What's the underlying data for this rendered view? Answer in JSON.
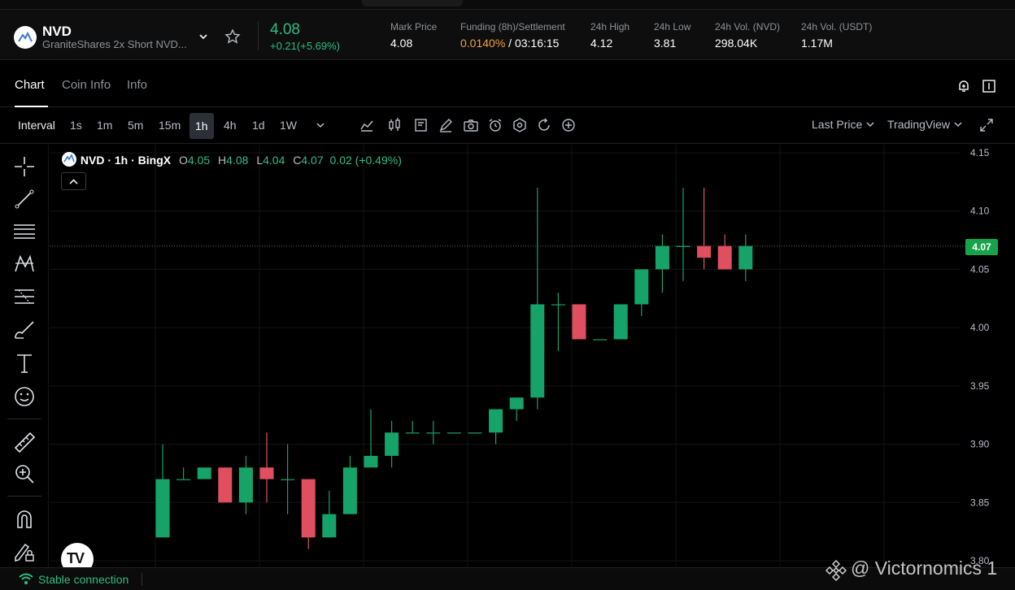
{
  "header": {
    "symbol": "NVD",
    "full_name": "GraniteShares 2x Short NVD...",
    "last_price": "4.08",
    "change": "+0.21(+5.69%)",
    "stats": [
      {
        "label": "Mark Price",
        "value": "4.08"
      },
      {
        "label": "24h High",
        "value": "4.12"
      },
      {
        "label": "24h Low",
        "value": "3.81"
      },
      {
        "label": "24h Vol. (NVD)",
        "value": "298.04K"
      },
      {
        "label": "24h Vol. (USDT)",
        "value": "1.17M"
      }
    ],
    "funding": {
      "label": "Funding (8h)/Settlement",
      "rate": "0.0140%",
      "countdown": " / 03:16:15"
    }
  },
  "tabs": [
    "Chart",
    "Coin Info",
    "Info"
  ],
  "toolbar": {
    "interval_label": "Interval",
    "intervals": [
      "1s",
      "1m",
      "5m",
      "15m",
      "1h",
      "4h",
      "1d",
      "1W"
    ],
    "selected_interval": "1h",
    "price_source": "Last Price",
    "chart_provider": "TradingView"
  },
  "legend": {
    "title": "NVD · 1h · BingX",
    "o_label": "O",
    "o": "4.05",
    "h_label": "H",
    "h": "4.08",
    "l_label": "L",
    "l": "4.04",
    "c_label": "C",
    "c": "4.07",
    "chg": "0.02 (+0.49%)"
  },
  "chart_data": {
    "type": "candlestick",
    "ylim": [
      3.8,
      4.15
    ],
    "y_ticks": [
      "4.15",
      "4.10",
      "4.05",
      "4.00",
      "3.95",
      "3.90",
      "3.85",
      "3.80"
    ],
    "current_price": "4.07",
    "candles": [
      {
        "o": 3.82,
        "h": 3.9,
        "l": 3.82,
        "c": 3.87
      },
      {
        "o": 3.87,
        "h": 3.88,
        "l": 3.87,
        "c": 3.87
      },
      {
        "o": 3.87,
        "h": 3.88,
        "l": 3.87,
        "c": 3.88
      },
      {
        "o": 3.88,
        "h": 3.88,
        "l": 3.85,
        "c": 3.85
      },
      {
        "o": 3.85,
        "h": 3.89,
        "l": 3.84,
        "c": 3.88
      },
      {
        "o": 3.88,
        "h": 3.91,
        "l": 3.85,
        "c": 3.87
      },
      {
        "o": 3.87,
        "h": 3.9,
        "l": 3.84,
        "c": 3.87
      },
      {
        "o": 3.87,
        "h": 3.87,
        "l": 3.81,
        "c": 3.82
      },
      {
        "o": 3.82,
        "h": 3.86,
        "l": 3.82,
        "c": 3.84
      },
      {
        "o": 3.84,
        "h": 3.89,
        "l": 3.84,
        "c": 3.88
      },
      {
        "o": 3.88,
        "h": 3.93,
        "l": 3.88,
        "c": 3.89
      },
      {
        "o": 3.89,
        "h": 3.92,
        "l": 3.88,
        "c": 3.91
      },
      {
        "o": 3.91,
        "h": 3.92,
        "l": 3.91,
        "c": 3.91
      },
      {
        "o": 3.91,
        "h": 3.92,
        "l": 3.9,
        "c": 3.91
      },
      {
        "o": 3.91,
        "h": 3.91,
        "l": 3.91,
        "c": 3.91
      },
      {
        "o": 3.91,
        "h": 3.91,
        "l": 3.91,
        "c": 3.91
      },
      {
        "o": 3.91,
        "h": 3.93,
        "l": 3.9,
        "c": 3.93
      },
      {
        "o": 3.93,
        "h": 3.94,
        "l": 3.92,
        "c": 3.94
      },
      {
        "o": 3.94,
        "h": 4.12,
        "l": 3.93,
        "c": 4.02
      },
      {
        "o": 4.02,
        "h": 4.03,
        "l": 3.98,
        "c": 4.02
      },
      {
        "o": 4.02,
        "h": 4.02,
        "l": 3.99,
        "c": 3.99
      },
      {
        "o": 3.99,
        "h": 3.99,
        "l": 3.99,
        "c": 3.99
      },
      {
        "o": 3.99,
        "h": 4.02,
        "l": 3.99,
        "c": 4.02
      },
      {
        "o": 4.02,
        "h": 4.05,
        "l": 4.01,
        "c": 4.05
      },
      {
        "o": 4.05,
        "h": 4.08,
        "l": 4.03,
        "c": 4.07
      },
      {
        "o": 4.07,
        "h": 4.12,
        "l": 4.04,
        "c": 4.07
      },
      {
        "o": 4.07,
        "h": 4.12,
        "l": 4.05,
        "c": 4.06
      },
      {
        "o": 4.07,
        "h": 4.08,
        "l": 4.05,
        "c": 4.05
      },
      {
        "o": 4.05,
        "h": 4.08,
        "l": 4.04,
        "c": 4.07
      }
    ],
    "up_color": "#16a369",
    "down_color": "#e04f5f",
    "grid": true
  },
  "footer": {
    "status": "Stable connection"
  },
  "watermark": "@ Victornomics 1"
}
